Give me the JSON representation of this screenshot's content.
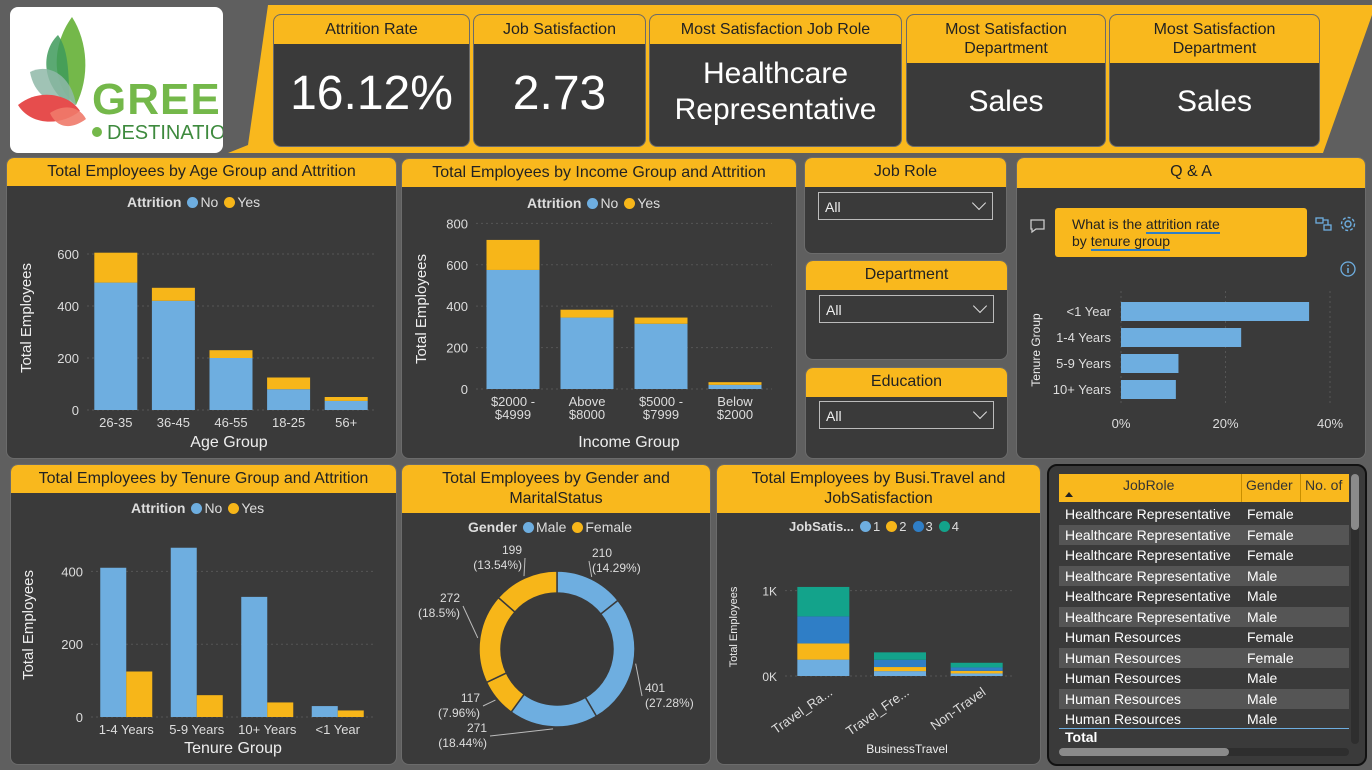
{
  "logo": {
    "line1": "GREEN",
    "line2": "DESTINATIONS"
  },
  "kpis": [
    {
      "label": "Attrition Rate",
      "value": "16.12%"
    },
    {
      "label": "Job Satisfaction",
      "value": "2.73"
    },
    {
      "label": "Most Satisfaction Job Role",
      "value_line1": "Healthcare",
      "value_line2": "Representative"
    },
    {
      "label_line1": "Most Satisfaction",
      "label_line2": "Department",
      "value": "Sales"
    },
    {
      "label_line1": "Most Satisfaction",
      "label_line2": "Department",
      "value": "Sales"
    }
  ],
  "colors": {
    "no": "#6eaee0",
    "yes": "#f7b619",
    "accent": "#f9b81d",
    "teal": "#13a38b",
    "blue3": "#2f7ec6"
  },
  "legend_attrition": {
    "title": "Attrition",
    "no": "No",
    "yes": "Yes"
  },
  "legend_gender": {
    "title": "Gender",
    "male": "Male",
    "female": "Female"
  },
  "legend_jobsat": {
    "title": "JobSatis...",
    "items": [
      "1",
      "2",
      "3",
      "4"
    ]
  },
  "titles": {
    "age": "Total Employees by Age Group and Attrition",
    "income": "Total Employees by Income Group and Attrition",
    "tenure": "Total Employees by Tenure Group and Attrition",
    "gender_line1": "Total Employees by Gender and",
    "gender_line2": "MaritalStatus",
    "travel_line1": "Total Employees by Busi.Travel and",
    "travel_line2": "JobSatisfaction",
    "qa": "Q & A"
  },
  "axes": {
    "total_employees": "Total Employees",
    "age_group": "Age Group",
    "income_group": "Income Group",
    "tenure_group": "Tenure Group",
    "business_travel": "BusinessTravel"
  },
  "chart_data": [
    {
      "type": "bar",
      "title": "Total Employees by Age Group and Attrition",
      "categories": [
        "26-35",
        "36-45",
        "46-55",
        "18-25",
        "56+"
      ],
      "series": [
        {
          "name": "No",
          "values": [
            490,
            420,
            200,
            80,
            35
          ]
        },
        {
          "name": "Yes",
          "values": [
            115,
            50,
            30,
            45,
            15
          ]
        }
      ],
      "ylim": [
        0,
        700
      ],
      "yticks": [
        "0",
        "200",
        "400",
        "600"
      ]
    },
    {
      "type": "bar",
      "title": "Total Employees by Income Group and Attrition",
      "categories": [
        "$2000 - $4999",
        "Above $8000",
        "$5000 - $7999",
        "Below $2000"
      ],
      "series": [
        {
          "name": "No",
          "values": [
            575,
            345,
            315,
            20
          ]
        },
        {
          "name": "Yes",
          "values": [
            145,
            38,
            30,
            13
          ]
        }
      ],
      "ylim": [
        0,
        850
      ],
      "yticks": [
        "0",
        "200",
        "400",
        "600",
        "800"
      ]
    },
    {
      "type": "bar",
      "title": "Total Employees by Tenure Group and Attrition",
      "categories": [
        "1-4 Years",
        "5-9 Years",
        "10+ Years",
        "<1 Year"
      ],
      "series": [
        {
          "name": "No",
          "values": [
            410,
            465,
            330,
            30
          ]
        },
        {
          "name": "Yes",
          "values": [
            125,
            60,
            40,
            18
          ]
        }
      ],
      "ylim": [
        0,
        500
      ],
      "yticks": [
        "0",
        "200",
        "400"
      ]
    },
    {
      "type": "pie",
      "title": "Total Employees by Gender and MaritalStatus",
      "slices": [
        {
          "label": "210",
          "pct": "(14.29%)",
          "value": 210,
          "gender": "Male"
        },
        {
          "label": "401",
          "pct": "(27.28%)",
          "value": 401,
          "gender": "Male"
        },
        {
          "label": "271",
          "pct": "(18.44%)",
          "value": 271,
          "gender": "Male"
        },
        {
          "label": "117",
          "pct": "(7.96%)",
          "value": 117,
          "gender": "Female"
        },
        {
          "label": "272",
          "pct": "(18.5%)",
          "value": 272,
          "gender": "Female"
        },
        {
          "label": "199",
          "pct": "(13.54%)",
          "value": 199,
          "gender": "Female"
        }
      ]
    },
    {
      "type": "bar",
      "title": "Total Employees by Busi.Travel and JobSatisfaction",
      "categories": [
        "Travel_Ra...",
        "Travel_Fre...",
        "Non-Travel"
      ],
      "series": [
        {
          "name": "1",
          "values": [
            192,
            57,
            30
          ]
        },
        {
          "name": "2",
          "values": [
            189,
            48,
            30
          ]
        },
        {
          "name": "3",
          "values": [
            317,
            85,
            40
          ]
        },
        {
          "name": "4",
          "values": [
            345,
            87,
            55
          ]
        }
      ],
      "ylim": [
        0,
        1300
      ],
      "yticks": [
        "0K",
        "1K"
      ]
    },
    {
      "type": "bar",
      "title": "Q & A",
      "categories": [
        "<1 Year",
        "1-4 Years",
        "5-9 Years",
        "10+ Years"
      ],
      "series": [
        {
          "name": "Attrition rate",
          "values": [
            0.36,
            0.23,
            0.11,
            0.105
          ]
        }
      ],
      "xlim": [
        0,
        0.4
      ],
      "xticks": [
        "0%",
        "20%",
        "40%"
      ],
      "ylabel": "Tenure Group"
    }
  ],
  "slicers": [
    {
      "label": "Job Role",
      "value": "All"
    },
    {
      "label": "Department",
      "value": "All"
    },
    {
      "label": "Education",
      "value": "All"
    }
  ],
  "qa": {
    "question_pre": "What is the ",
    "question_u1": "attrition rate",
    "question_mid": "by ",
    "question_u2": "tenure group"
  },
  "table": {
    "headers": [
      "JobRole",
      "Gender",
      "No. of"
    ],
    "rows": [
      [
        "Healthcare Representative",
        "Female"
      ],
      [
        "Healthcare Representative",
        "Female"
      ],
      [
        "Healthcare Representative",
        "Female"
      ],
      [
        "Healthcare Representative",
        "Male"
      ],
      [
        "Healthcare Representative",
        "Male"
      ],
      [
        "Healthcare Representative",
        "Male"
      ],
      [
        "Human Resources",
        "Female"
      ],
      [
        "Human Resources",
        "Female"
      ],
      [
        "Human Resources",
        "Male"
      ],
      [
        "Human Resources",
        "Male"
      ],
      [
        "Human Resources",
        "Male"
      ]
    ],
    "total_label": "Total"
  }
}
